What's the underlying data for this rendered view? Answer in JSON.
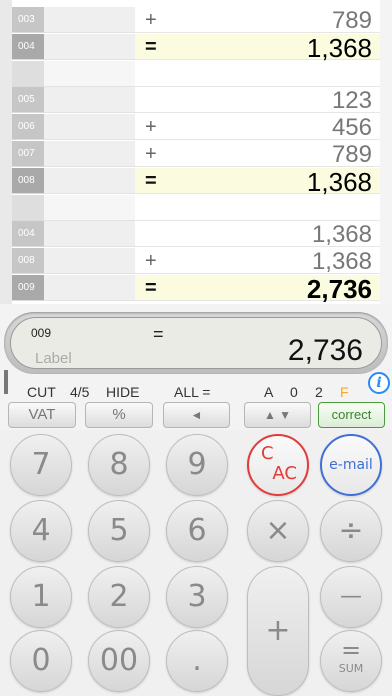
{
  "tape": {
    "rows": [
      {
        "num": "003",
        "op": "+",
        "value": "789",
        "type": "normal"
      },
      {
        "num": "004",
        "op": "=",
        "value": "1,368",
        "type": "total"
      },
      {
        "num": "",
        "op": "",
        "value": "",
        "type": "blank"
      },
      {
        "num": "005",
        "op": "",
        "value": "123",
        "type": "normal"
      },
      {
        "num": "006",
        "op": "+",
        "value": "456",
        "type": "normal"
      },
      {
        "num": "007",
        "op": "+",
        "value": "789",
        "type": "normal"
      },
      {
        "num": "008",
        "op": "=",
        "value": "1,368",
        "type": "total"
      },
      {
        "num": "",
        "op": "",
        "value": "",
        "type": "blank"
      },
      {
        "num": "004",
        "op": "",
        "value": "1,368",
        "type": "normal"
      },
      {
        "num": "008",
        "op": "+",
        "value": "1,368",
        "type": "normal"
      },
      {
        "num": "009",
        "op": "=",
        "value": "2,736",
        "type": "total bold"
      }
    ]
  },
  "display": {
    "number": "009",
    "operator": "=",
    "label_placeholder": "Label",
    "value": "2,736"
  },
  "function_bar": {
    "cut": "CUT",
    "round": "4/5",
    "hide": "HIDE",
    "all_eq": "ALL =",
    "mode_a": "A",
    "mode_0": "0",
    "mode_2": "2",
    "mode_f": "F",
    "info": "i",
    "vat": "VAT",
    "percent": "%",
    "back": "◄",
    "updown": "▲ ▼",
    "correct": "correct"
  },
  "keypad": {
    "k7": "7",
    "k8": "8",
    "k9": "9",
    "k4": "4",
    "k5": "5",
    "k6": "6",
    "k1": "1",
    "k2": "2",
    "k3": "3",
    "k0": "0",
    "k00": "00",
    "kdot": ".",
    "c": "C",
    "ac": "AC",
    "email": "e-mail",
    "times": "×",
    "divide": "÷",
    "minus": "—",
    "plus": "+",
    "equals": "=",
    "sum": "SUM"
  },
  "colors": {
    "accent_blue": "#2a8af6",
    "clear_red": "#e23b3b",
    "correct_green": "#4a9a3e",
    "total_highlight": "#fbfbe0",
    "fixed_orange": "#f5a623"
  }
}
